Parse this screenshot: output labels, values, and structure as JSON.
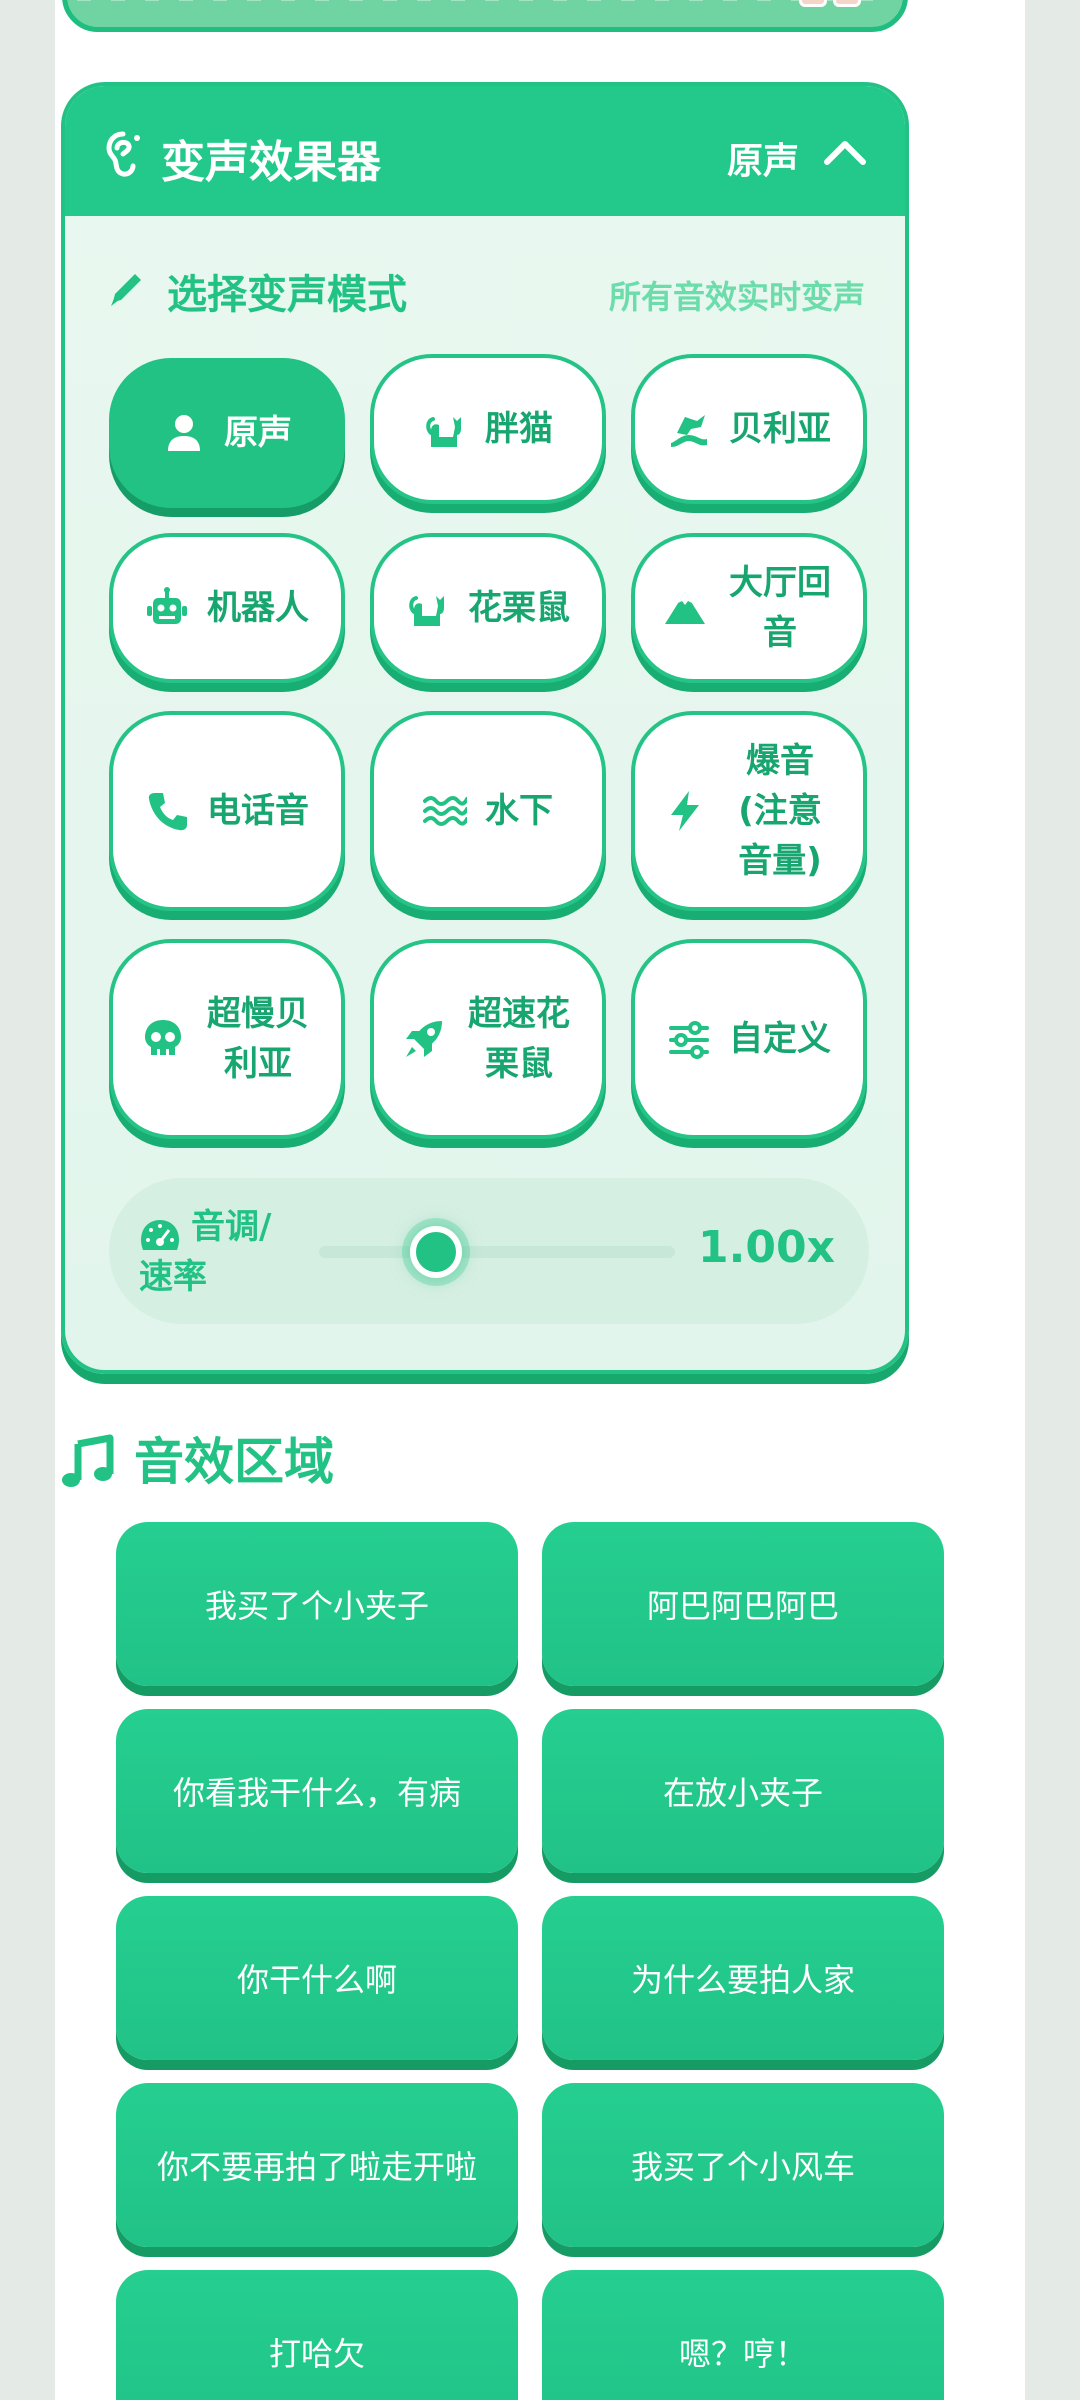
{
  "voice_changer": {
    "title": "变声效果器",
    "current_mode": "原声",
    "section_title": "选择变声模式",
    "hint": "所有音效实时变声",
    "modes": [
      {
        "label": "原声",
        "icon": "person-icon"
      },
      {
        "label": "胖猫",
        "icon": "cat-icon"
      },
      {
        "label": "贝利亚",
        "icon": "dragon-icon"
      },
      {
        "label": "机器人",
        "icon": "robot-icon"
      },
      {
        "label": "花栗鼠",
        "icon": "cat-icon"
      },
      {
        "label": "大厅回音",
        "icon": "mountain-icon"
      },
      {
        "label": "电话音",
        "icon": "phone-icon"
      },
      {
        "label": "水下",
        "icon": "water-icon"
      },
      {
        "label": "爆音(注意音量)",
        "icon": "bolt-icon"
      },
      {
        "label": "超慢贝利亚",
        "icon": "skull-icon"
      },
      {
        "label": "超速花栗鼠",
        "icon": "rocket-icon"
      },
      {
        "label": "自定义",
        "icon": "sliders-icon"
      }
    ],
    "pitch": {
      "label": "音调/速率",
      "value_text": "1.00x",
      "slider_fraction": 0.33
    }
  },
  "sound_effects": {
    "title": "音效区域",
    "items": [
      "我买了个小夹子",
      "阿巴阿巴阿巴",
      "你看我干什么，有病",
      "在放小夹子",
      "你干什么啊",
      "为什么要拍人家",
      "你不要再拍了啦走开啦",
      "我买了个小风车",
      "打哈欠",
      "嗯？哼！"
    ]
  },
  "colors": {
    "accent": "#22c284",
    "accent_dark": "#17a86e",
    "panel_bg": "#e6f7ee",
    "light_text": "#6bdcaa"
  }
}
